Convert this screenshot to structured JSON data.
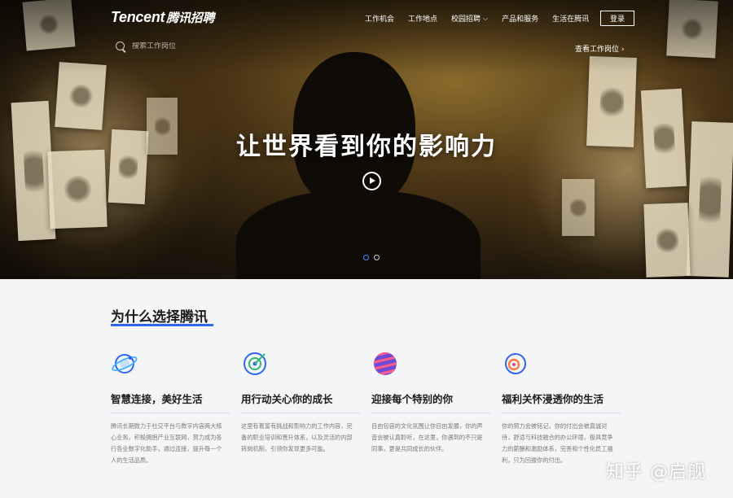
{
  "header": {
    "logo_text": "Tencent",
    "logo_cn": "腾讯招聘",
    "nav": [
      {
        "label": "工作机会"
      },
      {
        "label": "工作地点"
      },
      {
        "label": "校园招聘",
        "has_caret": true
      },
      {
        "label": "产品和服务"
      },
      {
        "label": "生活在腾讯"
      }
    ],
    "login_label": "登录",
    "search_placeholder": "搜索工作岗位",
    "view_jobs": "查看工作岗位 ›"
  },
  "hero": {
    "slogan": "让世界看到你的影响力",
    "carousel": {
      "count": 2,
      "active": 0
    }
  },
  "section": {
    "title": "为什么选择腾讯",
    "accent_color": "#2f66f1",
    "features": [
      {
        "icon": "planet-icon",
        "title": "智慧连接，美好生活",
        "desc": "腾讯长期致力于社交平台与数字内容两大核心业务，积极拥抱产业互联网，努力成为各行各业数字化助手，通过连接，提升每一个人的生活品质。"
      },
      {
        "icon": "target-icon",
        "title": "用行动关心你的成长",
        "desc": "这里有着富有挑战和影响力的工作内容，完备的职业培训和晋升体系，以及灵活的内部转岗机制，引领你发现更多可能。"
      },
      {
        "icon": "striped-ball-icon",
        "title": "迎接每个特别的你",
        "desc": "自由包容的文化氛围让你自由发展，你的声音会被认真聆听，在这里，你遇到的不只是同事，更是共同成长的伙伴。"
      },
      {
        "icon": "rings-icon",
        "title": "福利关怀浸透你的生活",
        "desc": "你的努力会被铭记，你的付出会被真诚对待，舒适与科技融合的办公环境，极具竞争力的薪酬和激励体系，完善和个性化员工福利，只为回报你的付出。"
      }
    ]
  },
  "watermark": "知乎 @启舰"
}
